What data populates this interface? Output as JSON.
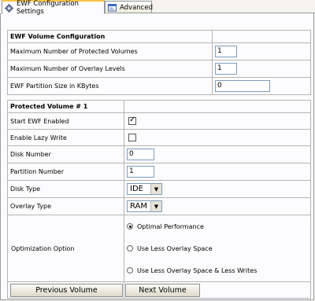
{
  "tabs": [
    {
      "label": "EWF Configuration Settings",
      "icon": "gear-icon",
      "active": true
    },
    {
      "label": "Advanced",
      "icon": "window-icon",
      "active": false
    }
  ],
  "volume_config": {
    "header": "EWF Volume Configuration",
    "max_protected_label": "Maximum Number of Protected Volumes",
    "max_protected_value": "1",
    "max_overlay_label": "Maximum Number of Overlay Levels",
    "max_overlay_value": "1",
    "partition_size_label": "EWF Partition Size in KBytes",
    "partition_size_value": "0"
  },
  "protected_volume": {
    "header": "Protected Volume # 1",
    "start_ewf_label": "Start EWF Enabled",
    "start_ewf_checked": true,
    "lazy_write_label": "Enable Lazy Write",
    "lazy_write_checked": false,
    "disk_number_label": "Disk Number",
    "disk_number_value": "0",
    "partition_number_label": "Partition Number",
    "partition_number_value": "1",
    "disk_type_label": "Disk Type",
    "disk_type_value": "IDE",
    "overlay_type_label": "Overlay Type",
    "overlay_type_value": "RAM",
    "optimization_label": "Optimization Option",
    "optimization_options": [
      {
        "label": "Optimal Performance",
        "selected": true
      },
      {
        "label": "Use Less Overlay Space",
        "selected": false
      },
      {
        "label": "Use Less Overlay Space & Less Writes",
        "selected": false
      }
    ]
  },
  "buttons": {
    "previous": "Previous Volume",
    "next": "Next Volume"
  }
}
